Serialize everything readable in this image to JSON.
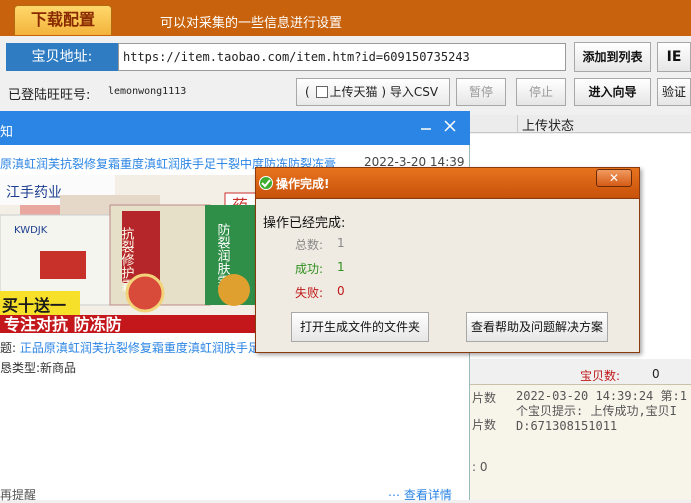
{
  "top_tab": {
    "label": "下载配置",
    "description": "可以对采集的一些信息进行设置"
  },
  "url_row": {
    "label": "宝贝地址:",
    "value": "https://item.taobao.com/item.htm?id=609150735243",
    "add_button": "添加到列表",
    "ie_button": "IE"
  },
  "login_row": {
    "label": "已登陆旺旺号:",
    "account": "lemonwong1113",
    "import_open_paren": "(",
    "tmall_checkbox_label": "上传天猫",
    "import_close_paren": ")",
    "import_csv": "导入CSV",
    "pause_button": "暂停",
    "stop_button": "停止",
    "guide_button": "进入向导",
    "verify_button": "验证"
  },
  "table": {
    "status_header": "上传状态"
  },
  "counter": {
    "label": "宝贝数:",
    "value": "0"
  },
  "log": {
    "left1": "片数",
    "left2": "片数",
    "left3": ": 0",
    "text": "2022-03-20 14:39:24 第:1 个宝贝提示: 上传成功,宝贝ID:671308151011"
  },
  "notification": {
    "title": "知",
    "minimize_icon": "minimize-icon",
    "close_icon": "close-icon",
    "item_title": "原滇虹润芙抗裂修复霜重度滇虹润肤手足干裂中度防冻防裂冻膏",
    "item_time": "2022-3-20 14:39",
    "line1_label": "题:",
    "line1_value": "正品原滇虹润芙抗裂修复霜重度滇虹润肤手足",
    "line2": "恳类型:新商品",
    "footer_left": "再提醒",
    "footer_right": "查看详情",
    "image": {
      "top_brand": "江手药业",
      "badge": "药",
      "product_text_1": "抗裂修护霜",
      "product_text_2": "防裂润肤霜",
      "promo": "买十送一",
      "banner": "专注对抗  防冻防",
      "box_brand": "KWDJK"
    }
  },
  "dialog": {
    "title": "操作完成!",
    "close_label": "✕",
    "heading": "操作已经完成:",
    "total_label": "总数:",
    "total_value": "1",
    "success_label": "成功:",
    "success_value": "1",
    "fail_label": "失败:",
    "fail_value": "0",
    "open_folder_button": "打开生成文件的文件夹",
    "help_button": "查看帮助及问题解决方案"
  },
  "colors": {
    "topbar": "#c8620c",
    "url_label_bg": "#2f7cc2",
    "notification_bar": "#2b85e4",
    "dialog_title": "#d8620f",
    "success": "#2f8f1f",
    "fail": "#c01818"
  }
}
